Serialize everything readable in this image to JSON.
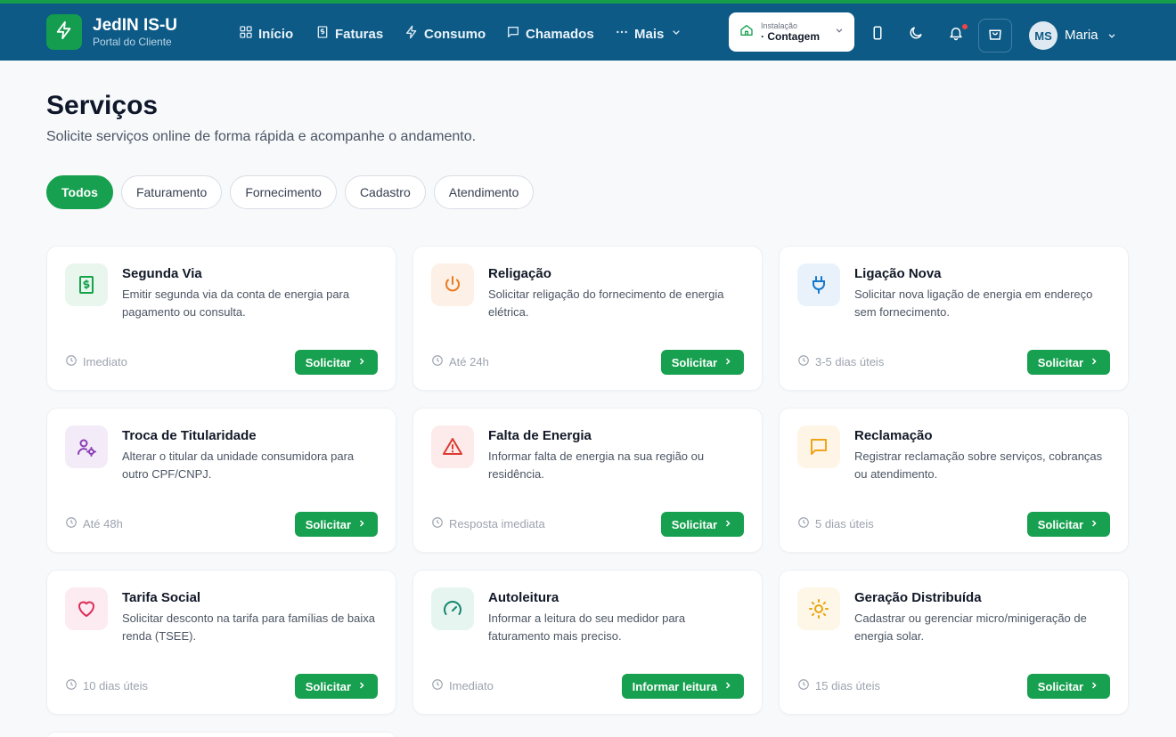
{
  "brand": {
    "name": "JedIN IS-U",
    "subtitle": "Portal do Cliente",
    "icon": "bolt-icon"
  },
  "nav": [
    {
      "label": "Início",
      "icon": "grid-icon"
    },
    {
      "label": "Faturas",
      "icon": "invoice-icon"
    },
    {
      "label": "Consumo",
      "icon": "bolt-icon"
    },
    {
      "label": "Chamados",
      "icon": "chat-icon"
    },
    {
      "label": "Mais",
      "icon": "more-icon"
    }
  ],
  "installation": {
    "label": "Instalação",
    "value": "· Contagem"
  },
  "user": {
    "initials": "MS",
    "name": "Maria"
  },
  "page": {
    "title": "Serviços",
    "subtitle": "Solicite serviços online de forma rápida e acompanhe o andamento."
  },
  "filters": [
    "Todos",
    "Faturamento",
    "Fornecimento",
    "Cadastro",
    "Atendimento"
  ],
  "services": [
    {
      "title": "Segunda Via",
      "desc": "Emitir segunda via da conta de energia para pagamento ou consulta.",
      "time": "Imediato",
      "button": "Solicitar",
      "icon": "dollar-doc-icon",
      "color": "#16a34a",
      "bg": "#e8f6ee"
    },
    {
      "title": "Religação",
      "desc": "Solicitar religação do fornecimento de energia elétrica.",
      "time": "Até 24h",
      "button": "Solicitar",
      "icon": "power-icon",
      "color": "#ea7a1e",
      "bg": "#fdf0e6"
    },
    {
      "title": "Ligação Nova",
      "desc": "Solicitar nova ligação de energia em endereço sem fornecimento.",
      "time": "3-5 dias úteis",
      "button": "Solicitar",
      "icon": "plug-icon",
      "color": "#1677c8",
      "bg": "#e9f2fb"
    },
    {
      "title": "Troca de Titularidade",
      "desc": "Alterar o titular da unidade consumidora para outro CPF/CNPJ.",
      "time": "Até 48h",
      "button": "Solicitar",
      "icon": "user-cog-icon",
      "color": "#8b3fb5",
      "bg": "#f3ebf8"
    },
    {
      "title": "Falta de Energia",
      "desc": "Informar falta de energia na sua região ou residência.",
      "time": "Resposta imediata",
      "button": "Solicitar",
      "icon": "warning-icon",
      "color": "#dc3b32",
      "bg": "#fcebea"
    },
    {
      "title": "Reclamação",
      "desc": "Registrar reclamação sobre serviços, cobranças ou atendimento.",
      "time": "5 dias úteis",
      "button": "Solicitar",
      "icon": "message-icon",
      "color": "#f0a41a",
      "bg": "#fef5e6"
    },
    {
      "title": "Tarifa Social",
      "desc": "Solicitar desconto na tarifa para famílias de baixa renda (TSEE).",
      "time": "10 dias úteis",
      "button": "Solicitar",
      "icon": "heart-icon",
      "color": "#dc2e5a",
      "bg": "#fcebf0"
    },
    {
      "title": "Autoleitura",
      "desc": "Informar a leitura do seu medidor para faturamento mais preciso.",
      "time": "Imediato",
      "button": "Informar leitura",
      "icon": "gauge-icon",
      "color": "#13876d",
      "bg": "#e7f5f1"
    },
    {
      "title": "Geração Distribuída",
      "desc": "Cadastrar ou gerenciar micro/minigeração de energia solar.",
      "time": "15 dias úteis",
      "button": "Solicitar",
      "icon": "sun-icon",
      "color": "#e8a512",
      "bg": "#fef6e6"
    }
  ]
}
